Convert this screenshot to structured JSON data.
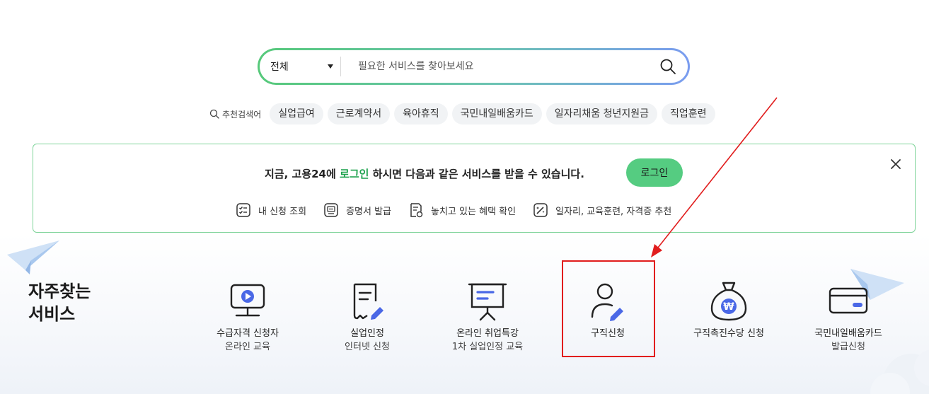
{
  "search": {
    "scope": "전체",
    "placeholder": "필요한 서비스를 찾아보세요"
  },
  "recommended": {
    "label": "추천검색어",
    "tags": [
      "실업급여",
      "근로계약서",
      "육아휴직",
      "국민내일배움카드",
      "일자리채움 청년지원금",
      "직업훈련"
    ]
  },
  "banner": {
    "msg_pre": "지금, 고용24에 ",
    "msg_link": "로그인",
    "msg_post": " 하시면 다음과 같은 서비스를 받을 수 있습니다.",
    "login_button": "로그인",
    "services": [
      "내 신청 조회",
      "증명서 발급",
      "놓치고 있는 혜택 확인",
      "일자리, 교육훈련, 자격증 추천"
    ]
  },
  "frequent": {
    "title_line1": "자주찾는",
    "title_line2": "서비스",
    "items": [
      {
        "line1": "수급자격 신청자",
        "line2": "온라인 교육"
      },
      {
        "line1": "실업인정",
        "line2": "인터넷 신청"
      },
      {
        "line1": "온라인 취업특강",
        "line2": "1차 실업인정 교육"
      },
      {
        "line1": "구직신청",
        "line2": ""
      },
      {
        "line1": "구직촉진수당 신청",
        "line2": ""
      },
      {
        "line1": "국민내일배움카드",
        "line2": "발급신청"
      }
    ]
  },
  "icons": {
    "search": "search-icon",
    "close": "close-icon",
    "caret": "caret-down-icon",
    "video": "video-lecture-icon",
    "document-pen": "document-edit-icon",
    "presentation": "presentation-board-icon",
    "person-pen": "person-edit-icon",
    "money-bag": "money-bag-icon",
    "card": "credit-card-icon"
  },
  "colors": {
    "accent_green": "#55cc81",
    "highlight_text": "#1fa34f",
    "icon_blue": "#4a68e6",
    "annotation_red": "#e11d1d"
  }
}
